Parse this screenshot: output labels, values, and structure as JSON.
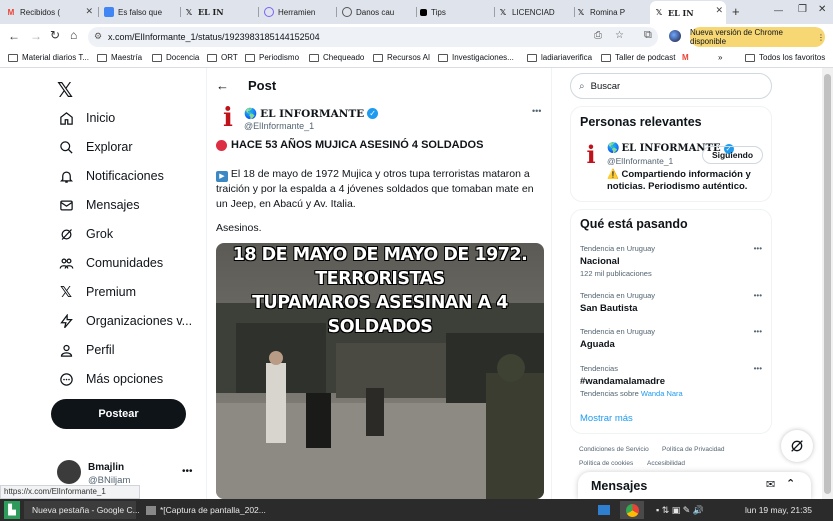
{
  "tabs": [
    {
      "label": "Recibidos (",
      "icon": "gmail-icon",
      "color": "#ea4335"
    },
    {
      "label": "Es falso que",
      "icon": "docs-icon",
      "color": "#4285f4"
    },
    {
      "label": "EL IN",
      "icon": "x-icon",
      "color": "#000000"
    },
    {
      "label": "Herramien",
      "icon": "tool-icon",
      "color": "#7b61ff"
    },
    {
      "label": "Danos cau",
      "icon": "globe-icon",
      "color": "#555555"
    },
    {
      "label": "Tips",
      "icon": "tips-icon",
      "color": "#000000"
    },
    {
      "label": "LICENCIAD",
      "icon": "x-icon",
      "color": "#000000"
    },
    {
      "label": "Romina P",
      "icon": "x-icon",
      "color": "#000000"
    },
    {
      "label": "EL IN",
      "icon": "x-icon",
      "color": "#000000"
    }
  ],
  "toolbar": {
    "url": "x.com/ElInformante_1/status/1923983185144152504",
    "update_label": "Nueva versión de Chrome disponible"
  },
  "bookmarks": [
    {
      "label": "Material diarios T..."
    },
    {
      "label": "Maestría"
    },
    {
      "label": "Docencia"
    },
    {
      "label": "ORT"
    },
    {
      "label": "Periodismo"
    },
    {
      "label": "Chequeado"
    },
    {
      "label": "Recursos AI"
    },
    {
      "label": "Investigaciones..."
    },
    {
      "label": "ladiariaverifica"
    },
    {
      "label": "Taller de podcast"
    },
    {
      "label": "Todos los favoritos"
    }
  ],
  "nav": {
    "items": [
      {
        "label": "Inicio",
        "icon": "home-icon"
      },
      {
        "label": "Explorar",
        "icon": "search-icon"
      },
      {
        "label": "Notificaciones",
        "icon": "bell-icon"
      },
      {
        "label": "Mensajes",
        "icon": "mail-icon"
      },
      {
        "label": "Grok",
        "icon": "grok-icon"
      },
      {
        "label": "Comunidades",
        "icon": "communities-icon"
      },
      {
        "label": "Premium",
        "icon": "x-icon"
      },
      {
        "label": "Organizaciones v...",
        "icon": "lightning-icon"
      },
      {
        "label": "Perfil",
        "icon": "person-icon"
      },
      {
        "label": "Más opciones",
        "icon": "more-circle-icon"
      }
    ],
    "post_label": "Postear",
    "account_name": "Bmajlin",
    "account_handle": "@BNiljam"
  },
  "post": {
    "header": "Post",
    "author_name": "EL INFORMANTE",
    "author_handle": "@ElInformante_1",
    "headline": "HACE 53 AÑOS MUJICA ASESINÓ 4 SOLDADOS",
    "body": "El 18 de mayo de 1972 Mujica y otros tupa terroristas mataron a traición y por la espalda a 4 jóvenes soldados que tomaban mate en un Jeep, en Abacú y Av. Italia.",
    "body2": "Asesinos.",
    "video_caption_line1": "18 DE MAYO DE MAYO DE 1972. TERRORISTAS",
    "video_caption_line2": "TUPAMAROS ASESINAN A 4 SOLDADOS"
  },
  "search": {
    "placeholder": "Buscar"
  },
  "relevant": {
    "title": "Personas relevantes",
    "name": "EL INFORMANTE",
    "handle": "@ElInformante_1",
    "follow_label": "Siguiendo",
    "bio": "Compartiendo información y noticias. Periodismo auténtico."
  },
  "trends": {
    "title": "Qué está pasando",
    "items": [
      {
        "context": "Tendencia en Uruguay",
        "name": "Nacional",
        "count": "122 mil publicaciones"
      },
      {
        "context": "Tendencia en Uruguay",
        "name": "San Bautista",
        "count": ""
      },
      {
        "context": "Tendencia en Uruguay",
        "name": "Aguada",
        "count": ""
      },
      {
        "context": "Tendencias",
        "name": "#wandamalamadre",
        "count": "Tendencias sobre",
        "link": "Wanda Nara"
      }
    ],
    "more_label": "Mostrar más"
  },
  "footer_links": [
    "Condiciones de Servicio",
    "Política de Privacidad",
    "Política de cookies",
    "Accesibilidad"
  ],
  "messages_label": "Mensajes",
  "status_url": "https://x.com/ElInformante_1",
  "taskbar": {
    "items": [
      "Nueva pestaña - Google C...",
      "*[Captura de pantalla_202..."
    ],
    "clock": "lun 19 may, 21:35"
  }
}
